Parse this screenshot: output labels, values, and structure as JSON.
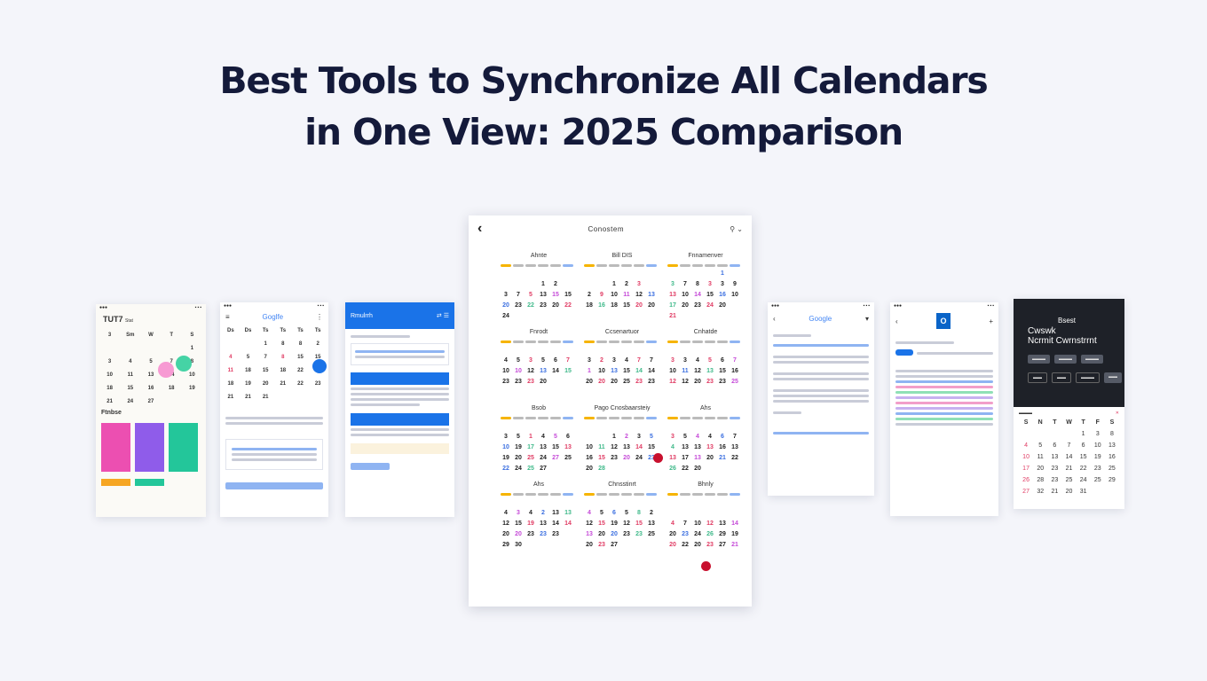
{
  "headline": {
    "line1": "Best Tools to Synchronize All Calendars",
    "line2": "in One View: 2025 Comparison"
  },
  "colors": {
    "accent_blue": "#1a73e8",
    "title": "#141a3a",
    "highlight_red": "#c8102e"
  },
  "cards": {
    "card1": {
      "title": "TUT7",
      "sub": "Stat",
      "tasks_label": "Ftnbse"
    },
    "card2": {
      "logo": "Goglfe"
    },
    "card3": {
      "title": "Rmulrrh"
    },
    "card5": {
      "logo": "Google"
    },
    "card7": {
      "t1": "Bsest",
      "t2": "Cwswk",
      "t3": "Ncrmit Cwrnstrrnt",
      "weekdays": [
        "S",
        "N",
        "T",
        "W",
        "T",
        "F",
        "S"
      ]
    }
  },
  "main_calendar": {
    "title": "Conostem",
    "months": [
      {
        "name": "Ahnte",
        "days": [
          "",
          "",
          "",
          "",
          "",
          "",
          "",
          "",
          "",
          "1",
          "2",
          "",
          "3",
          "7",
          "5",
          "13",
          "15",
          "15",
          "20",
          "23",
          "22",
          "23",
          "20",
          "22",
          "24",
          "",
          "",
          "",
          "",
          ""
        ]
      },
      {
        "name": "Bill DIS",
        "days": [
          "",
          "",
          "",
          "",
          "",
          "",
          "",
          "",
          "1",
          "2",
          "3",
          "",
          "2",
          "9",
          "10",
          "11",
          "12",
          "13",
          "18",
          "16",
          "18",
          "15",
          "20",
          "20",
          "",
          "",
          "",
          "",
          "",
          ""
        ]
      },
      {
        "name": "Fnnamenver",
        "days": [
          "",
          "",
          "",
          "",
          "1",
          "",
          "3",
          "7",
          "8",
          "3",
          "3",
          "9",
          "13",
          "10",
          "14",
          "15",
          "16",
          "10",
          "17",
          "20",
          "23",
          "24",
          "20",
          "",
          "21",
          "",
          "",
          "",
          "",
          ""
        ]
      },
      {
        "name": "Fnrodt",
        "days": [
          "",
          "",
          "",
          "",
          "",
          "",
          "4",
          "5",
          "3",
          "5",
          "6",
          "7",
          "10",
          "10",
          "12",
          "13",
          "14",
          "15",
          "23",
          "23",
          "23",
          "20",
          "",
          "",
          "",
          "",
          "",
          "",
          "",
          ""
        ]
      },
      {
        "name": "Ccsenartuor",
        "days": [
          "",
          "",
          "",
          "",
          "",
          "",
          "3",
          "2",
          "3",
          "4",
          "7",
          "7",
          "1",
          "10",
          "13",
          "15",
          "14",
          "14",
          "20",
          "20",
          "20",
          "25",
          "23",
          "23",
          "",
          "",
          "",
          "",
          "",
          ""
        ]
      },
      {
        "name": "Cnhatde",
        "days": [
          "",
          "",
          "",
          "",
          "",
          "",
          "3",
          "3",
          "4",
          "5",
          "6",
          "7",
          "10",
          "11",
          "12",
          "13",
          "15",
          "16",
          "12",
          "12",
          "20",
          "23",
          "23",
          "25",
          "",
          "",
          "",
          "",
          "",
          ""
        ]
      },
      {
        "name": "Bsob",
        "days": [
          "",
          "",
          "",
          "",
          "",
          "",
          "3",
          "5",
          "1",
          "4",
          "5",
          "6",
          "10",
          "19",
          "17",
          "13",
          "15",
          "13",
          "19",
          "20",
          "25",
          "24",
          "27",
          "25",
          "22",
          "24",
          "25",
          "27",
          "",
          ""
        ]
      },
      {
        "name": "Pago Cnosbaarsteiy",
        "days": [
          "",
          "",
          "",
          "",
          "",
          "",
          "",
          "",
          "1",
          "2",
          "3",
          "5",
          "10",
          "11",
          "12",
          "13",
          "14",
          "15",
          "16",
          "15",
          "23",
          "20",
          "24",
          "23",
          "20",
          "28",
          "",
          "",
          "",
          ""
        ]
      },
      {
        "name": "Ahs",
        "days": [
          "",
          "",
          "",
          "",
          "",
          "",
          "3",
          "5",
          "4",
          "4",
          "6",
          "7",
          "4",
          "13",
          "13",
          "13",
          "16",
          "13",
          "13",
          "17",
          "13",
          "20",
          "21",
          "22",
          "26",
          "22",
          "20",
          "",
          "",
          ""
        ]
      },
      {
        "name": "Ahs",
        "days": [
          "",
          "",
          "",
          "",
          "",
          "",
          "4",
          "3",
          "4",
          "2",
          "13",
          "13",
          "12",
          "15",
          "19",
          "13",
          "14",
          "14",
          "20",
          "20",
          "23",
          "23",
          "23",
          "",
          "29",
          "30",
          "",
          "",
          "",
          ""
        ]
      },
      {
        "name": "Chnsstinrt",
        "days": [
          "",
          "",
          "",
          "",
          "",
          "",
          "4",
          "5",
          "6",
          "5",
          "8",
          "2",
          "12",
          "15",
          "19",
          "12",
          "15",
          "13",
          "13",
          "20",
          "20",
          "23",
          "23",
          "25",
          "20",
          "23",
          "27",
          "",
          "",
          ""
        ]
      },
      {
        "name": "Bhnly",
        "days": [
          "",
          "",
          "",
          "",
          "",
          "",
          "",
          "",
          "",
          "",
          "",
          "",
          "4",
          "7",
          "10",
          "12",
          "13",
          "14",
          "20",
          "23",
          "24",
          "26",
          "29",
          "19",
          "20",
          "22",
          "20",
          "23",
          "27",
          "21"
        ]
      }
    ]
  },
  "card7_days": [
    "",
    "",
    "",
    "",
    "1",
    "3",
    "8",
    "4",
    "5",
    "6",
    "7",
    "6",
    "10",
    "13",
    "10",
    "11",
    "13",
    "14",
    "15",
    "19",
    "16",
    "17",
    "20",
    "23",
    "21",
    "22",
    "23",
    "25",
    "26",
    "28",
    "23",
    "25",
    "24",
    "25",
    "29",
    "27",
    "32",
    "21",
    "20",
    "31",
    "",
    "",
    ""
  ]
}
